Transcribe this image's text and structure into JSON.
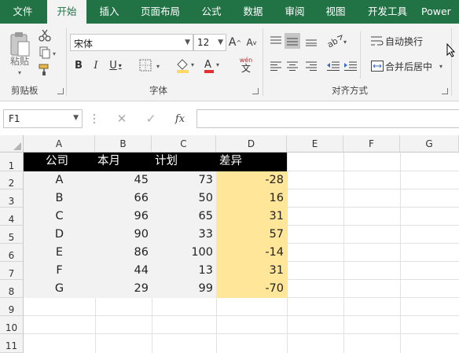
{
  "tabs": [
    {
      "label": "文件",
      "active": false
    },
    {
      "label": "开始",
      "active": true
    },
    {
      "label": "插入",
      "active": false
    },
    {
      "label": "页面布局",
      "active": false
    },
    {
      "label": "公式",
      "active": false
    },
    {
      "label": "数据",
      "active": false
    },
    {
      "label": "审阅",
      "active": false
    },
    {
      "label": "视图",
      "active": false
    },
    {
      "label": "开发工具",
      "active": false
    },
    {
      "label": "Power",
      "active": false
    }
  ],
  "ribbon": {
    "clipboard": {
      "paste_label": "粘贴",
      "group_label": "剪贴板"
    },
    "font": {
      "font_name": "宋体",
      "font_size": "12",
      "group_label": "字体",
      "wen_label": "wén",
      "wen_char": "文"
    },
    "alignment": {
      "wrap_label": "自动换行",
      "merge_label": "合并后居中",
      "group_label": "对齐方式"
    }
  },
  "formula_bar": {
    "name_box": "F1",
    "fx_label": "fx",
    "formula": ""
  },
  "columns": [
    "A",
    "B",
    "C",
    "D",
    "E",
    "F",
    "G"
  ],
  "rows": [
    "1",
    "2",
    "3",
    "4",
    "5",
    "6",
    "7",
    "8",
    "9",
    "10",
    "11"
  ],
  "table": {
    "headers": [
      "公司",
      "本月",
      "计划",
      "差异"
    ],
    "rows": [
      [
        "A",
        "45",
        "73",
        "-28"
      ],
      [
        "B",
        "66",
        "50",
        "16"
      ],
      [
        "C",
        "96",
        "65",
        "31"
      ],
      [
        "D",
        "90",
        "33",
        "57"
      ],
      [
        "E",
        "86",
        "100",
        "-14"
      ],
      [
        "F",
        "44",
        "13",
        "31"
      ],
      [
        "G",
        "29",
        "99",
        "-70"
      ]
    ]
  },
  "colors": {
    "accent": "#217346",
    "header_fill": "#000000",
    "diff_fill": "#ffe699",
    "data_fill": "#f2f2f2"
  }
}
